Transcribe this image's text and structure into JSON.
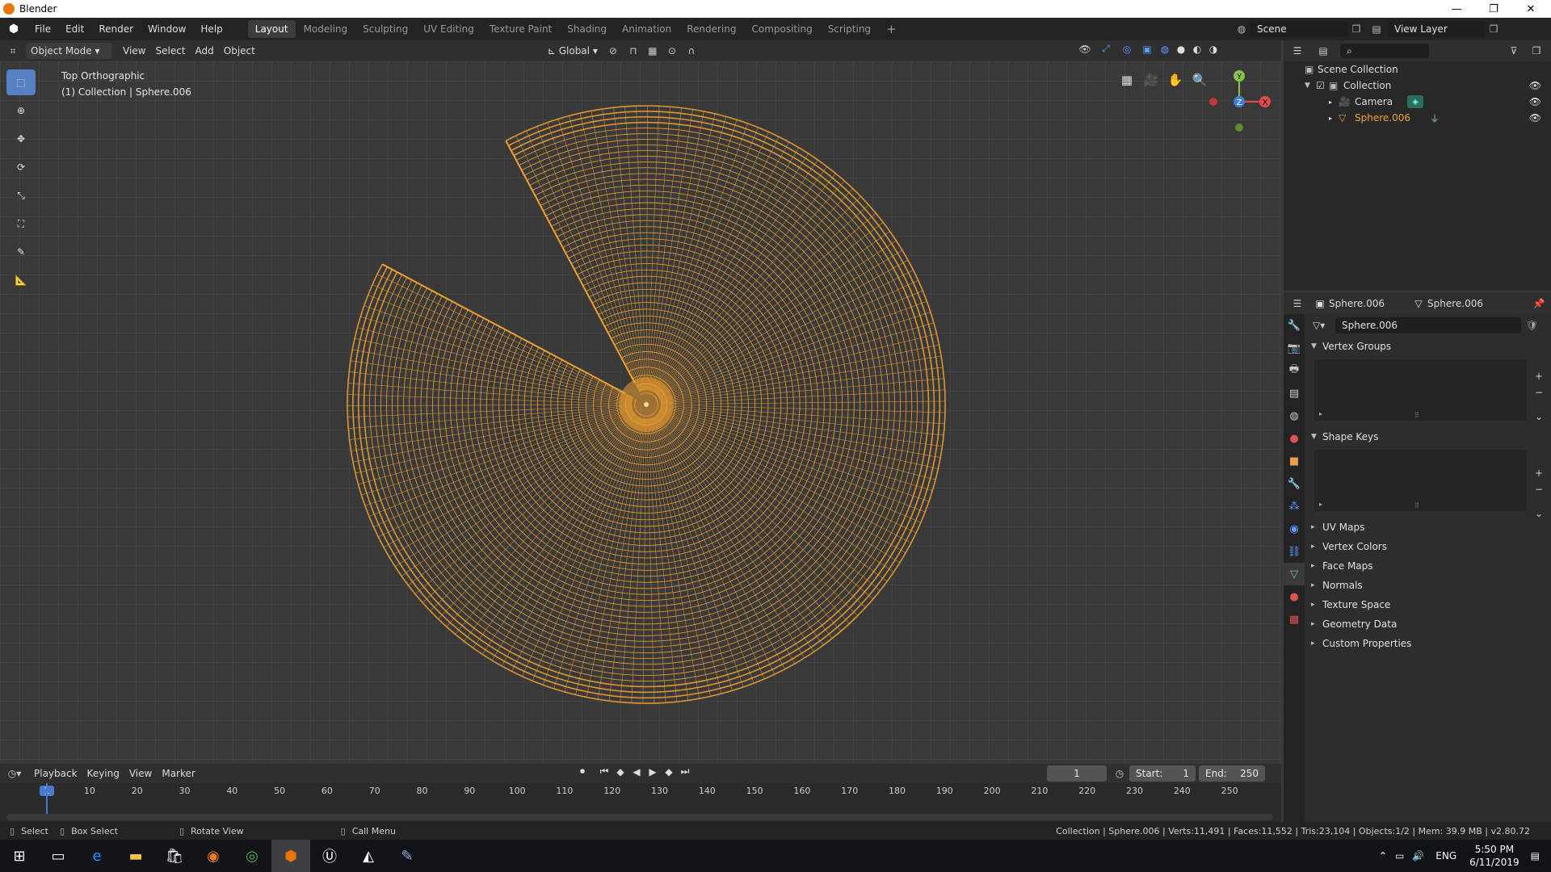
{
  "window": {
    "title": "Blender",
    "minimize_glyph": "—",
    "maximize_glyph": "❐",
    "close_glyph": "✕"
  },
  "menu": {
    "items": [
      "File",
      "Edit",
      "Render",
      "Window",
      "Help"
    ],
    "workspaces": [
      "Layout",
      "Modeling",
      "Sculpting",
      "UV Editing",
      "Texture Paint",
      "Shading",
      "Animation",
      "Rendering",
      "Compositing",
      "Scripting"
    ],
    "add_workspace": "+",
    "scene": "Scene",
    "view_layer": "View Layer"
  },
  "viewport_header": {
    "mode": "Object Mode",
    "menus": [
      "View",
      "Select",
      "Add",
      "Object"
    ],
    "transform_orientation": "Global"
  },
  "viewport": {
    "view_name": "Top Orthographic",
    "context": "(1) Collection | Sphere.006",
    "gizmo_labels": {
      "y": "Y",
      "z": "Z",
      "x": "X"
    },
    "wire_color": "#f0a030"
  },
  "outliner": {
    "search_placeholder": "",
    "root": "Scene Collection",
    "collection": "Collection",
    "objects": [
      {
        "name": "Camera",
        "selected": false
      },
      {
        "name": "Sphere.006",
        "selected": true
      }
    ]
  },
  "properties": {
    "object_name": "Sphere.006",
    "data_name": "Sphere.006",
    "mesh_field": "Sphere.006",
    "panels_open": [
      "Vertex Groups",
      "Shape Keys"
    ],
    "panels_closed": [
      "UV Maps",
      "Vertex Colors",
      "Face Maps",
      "Normals",
      "Texture Space",
      "Geometry Data",
      "Custom Properties"
    ]
  },
  "timeline": {
    "menus": [
      "Playback",
      "Keying",
      "View",
      "Marker"
    ],
    "current_frame": "1",
    "start_label": "Start:",
    "start": "1",
    "end_label": "End:",
    "end": "250",
    "ruler": [
      "1",
      "10",
      "20",
      "30",
      "40",
      "50",
      "60",
      "70",
      "80",
      "90",
      "100",
      "110",
      "120",
      "130",
      "140",
      "150",
      "160",
      "170",
      "180",
      "190",
      "200",
      "210",
      "220",
      "230",
      "240",
      "250"
    ]
  },
  "statusbar": {
    "select": "Select",
    "box_select": "Box Select",
    "rotate_view": "Rotate View",
    "call_menu": "Call Menu",
    "stats": "Collection | Sphere.006 | Verts:11,491 | Faces:11,552 | Tris:23,104 | Objects:1/2 | Mem: 39.9 MB | v2.80.72"
  },
  "taskbar": {
    "lang": "ENG",
    "time": "5:50 PM",
    "date": "6/11/2019"
  },
  "colors": {
    "accent": "#5680c2",
    "object_orange": "#ea9c2c",
    "selected_text": "#f2a23a"
  }
}
